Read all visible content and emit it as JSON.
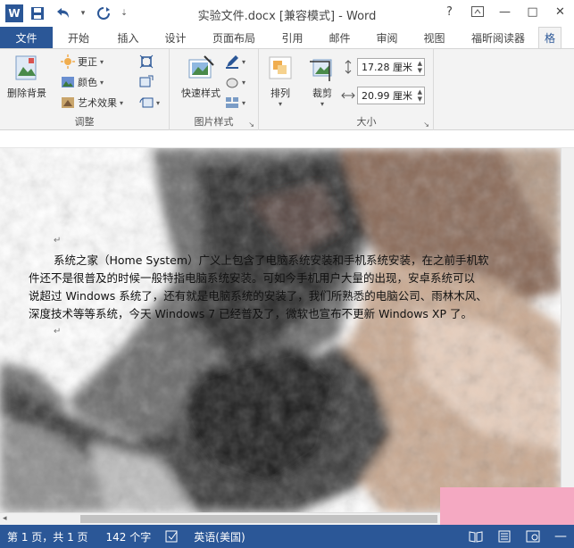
{
  "window": {
    "title": "实验文件.docx [兼容模式] - Word",
    "logo": "W",
    "help": "?",
    "minimize": "—",
    "maximize": "□",
    "close": "✕"
  },
  "qat": {
    "save_icon": "save-icon",
    "undo_icon": "undo-icon",
    "redo_icon": "redo-icon"
  },
  "tabs": [
    {
      "label": "文件"
    },
    {
      "label": "开始"
    },
    {
      "label": "插入"
    },
    {
      "label": "设计"
    },
    {
      "label": "页面布局"
    },
    {
      "label": "引用"
    },
    {
      "label": "邮件"
    },
    {
      "label": "审阅"
    },
    {
      "label": "视图"
    },
    {
      "label": "福昕阅读器"
    },
    {
      "label": "格"
    }
  ],
  "ribbon": {
    "remove_bg": "删除背景",
    "corrections": "更正",
    "color": "颜色",
    "artistic": "艺术效果",
    "adjust_label": "调整",
    "quick_styles": "快速样式",
    "pic_styles_label": "图片样式",
    "arrange": "排列",
    "crop": "裁剪",
    "height": "17.28 厘米",
    "width": "20.99 厘米",
    "size_label": "大小"
  },
  "document": {
    "lines": [
      "系统之家（Home System）广义上包含了电脑系统安装和手机系统安装，在之前手机软",
      "件还不是很普及的时候一般特指电脑系统安装。可如今手机用户大量的出现，安卓系统可以",
      "说超过 Windows 系统了，还有就是电脑系统的安装了，我们所熟悉的电脑公司、雨林木风、",
      "深度技术等等系统，今天 Windows 7 已经普及了，微软也宣布不更新 Windows XP 了。"
    ],
    "para_mark": "↵"
  },
  "status": {
    "page": "第 1 页，共 1 页",
    "words": "142 个字",
    "language": "英语(美国)"
  },
  "colors": {
    "accent": "#2b5797",
    "ribbon_bg": "#f3f3f3",
    "pink": "#f5a9c2"
  }
}
